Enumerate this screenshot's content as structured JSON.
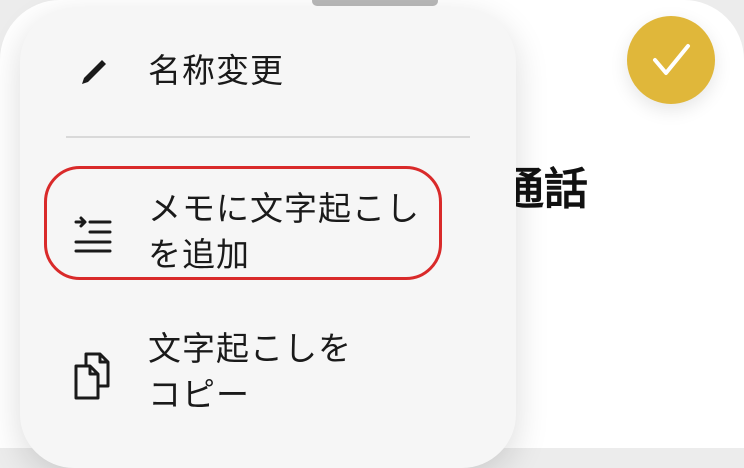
{
  "background": {
    "title": "通話"
  },
  "done_button": {
    "icon": "checkmark-icon",
    "color": "#e0b73a"
  },
  "menu": {
    "items": [
      {
        "label_lines": [
          "名称変更"
        ],
        "icon": "pencil-icon"
      },
      {
        "label_lines": [
          "メモに文字起こし",
          "を追加"
        ],
        "icon": "add-transcript-icon",
        "highlighted": true
      },
      {
        "label_lines": [
          "文字起こしを",
          "コピー"
        ],
        "icon": "copy-icon"
      }
    ]
  },
  "colors": {
    "menu_background": "#f6f6f6",
    "highlight": "#d92a2a",
    "text": "#1a1a1a"
  }
}
